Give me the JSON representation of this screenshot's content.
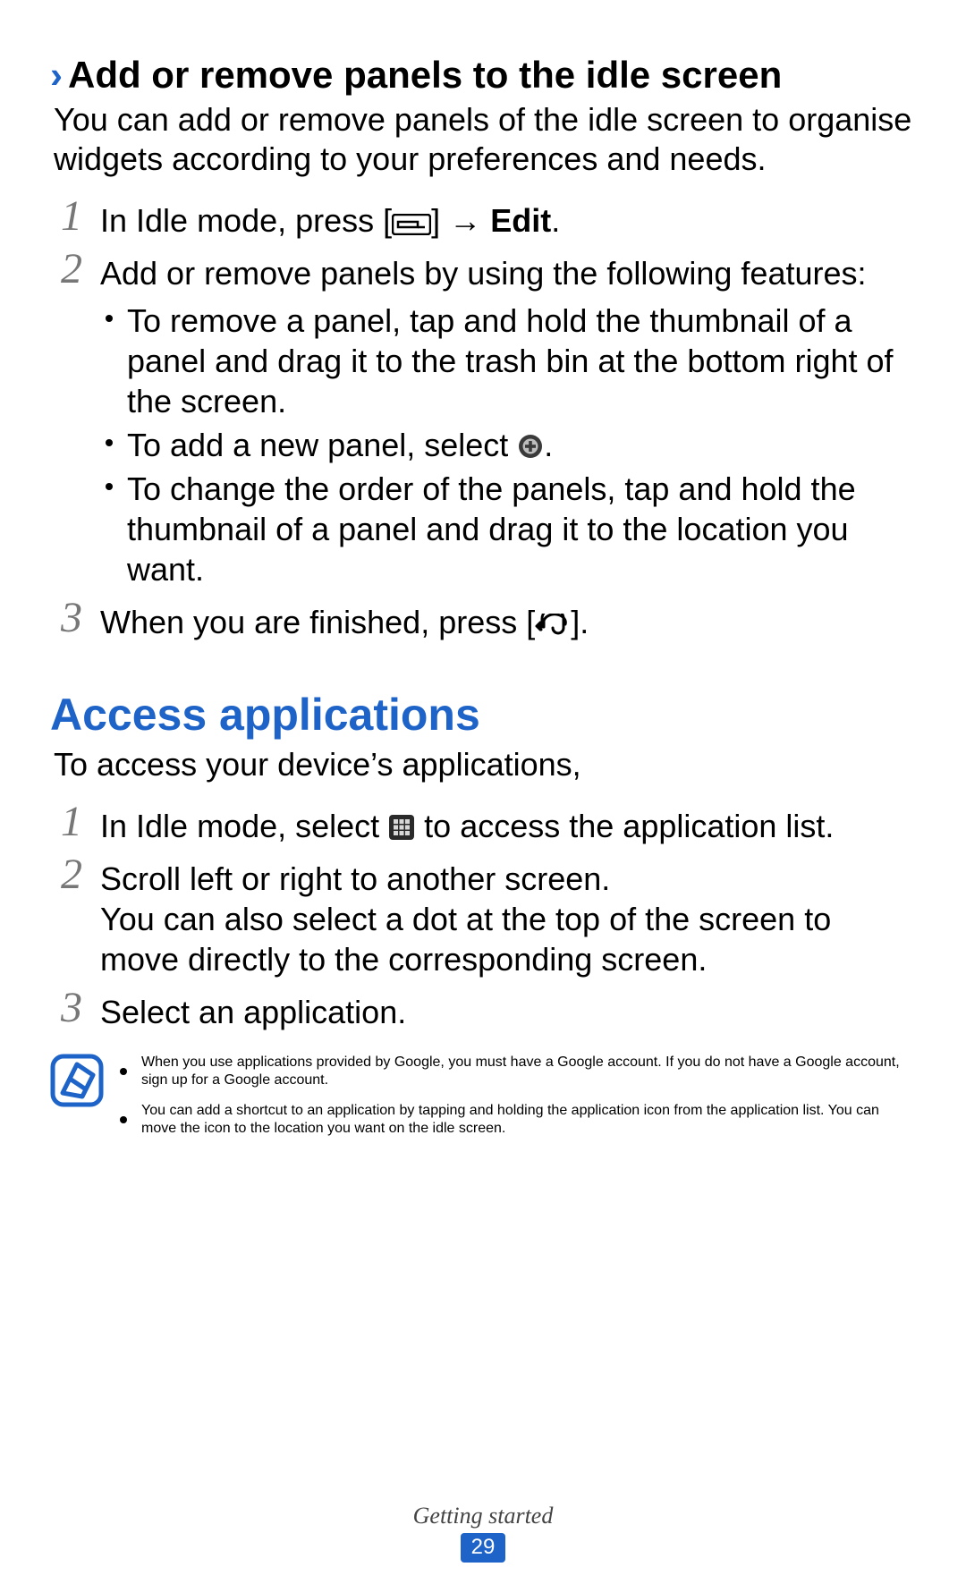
{
  "section1": {
    "heading": "Add or remove panels to the idle screen",
    "intro": "You can add or remove panels of the idle screen to organise widgets according to your preferences and needs.",
    "steps": [
      {
        "n": "1",
        "pre": "In Idle mode, press [",
        "post": "] → ",
        "bold": "Edit",
        "tail": "."
      },
      {
        "n": "2",
        "text": "Add or remove panels by using the following features:"
      },
      {
        "n": "3",
        "pre": "When you are finished, press [",
        "post": "]."
      }
    ],
    "bullets": [
      "To remove a panel, tap and hold the thumbnail of a panel and drag it to the trash bin at the bottom right of the screen.",
      "",
      "To change the order of the panels, tap and hold the thumbnail of a panel and drag it to the location you want."
    ],
    "bullet2_pre": "To add a new panel, select ",
    "bullet2_post": "."
  },
  "section2": {
    "heading": "Access applications",
    "intro": "To access your device’s applications,",
    "steps": [
      {
        "n": "1",
        "pre": "In Idle mode, select ",
        "post": " to access the application list."
      },
      {
        "n": "2",
        "text": "Scroll left or right to another screen.",
        "extra": "You can also select a dot at the top of the screen to move directly to the corresponding screen."
      },
      {
        "n": "3",
        "text": "Select an application."
      }
    ],
    "note": [
      "When you use applications provided by Google, you must have a Google account. If you do not have a Google account, sign up for a Google account.",
      "You can add a shortcut to an application by tapping and holding the application icon from the application list. You can move the icon to the location you want on the idle screen."
    ]
  },
  "footer": {
    "chapter": "Getting started",
    "page": "29"
  }
}
